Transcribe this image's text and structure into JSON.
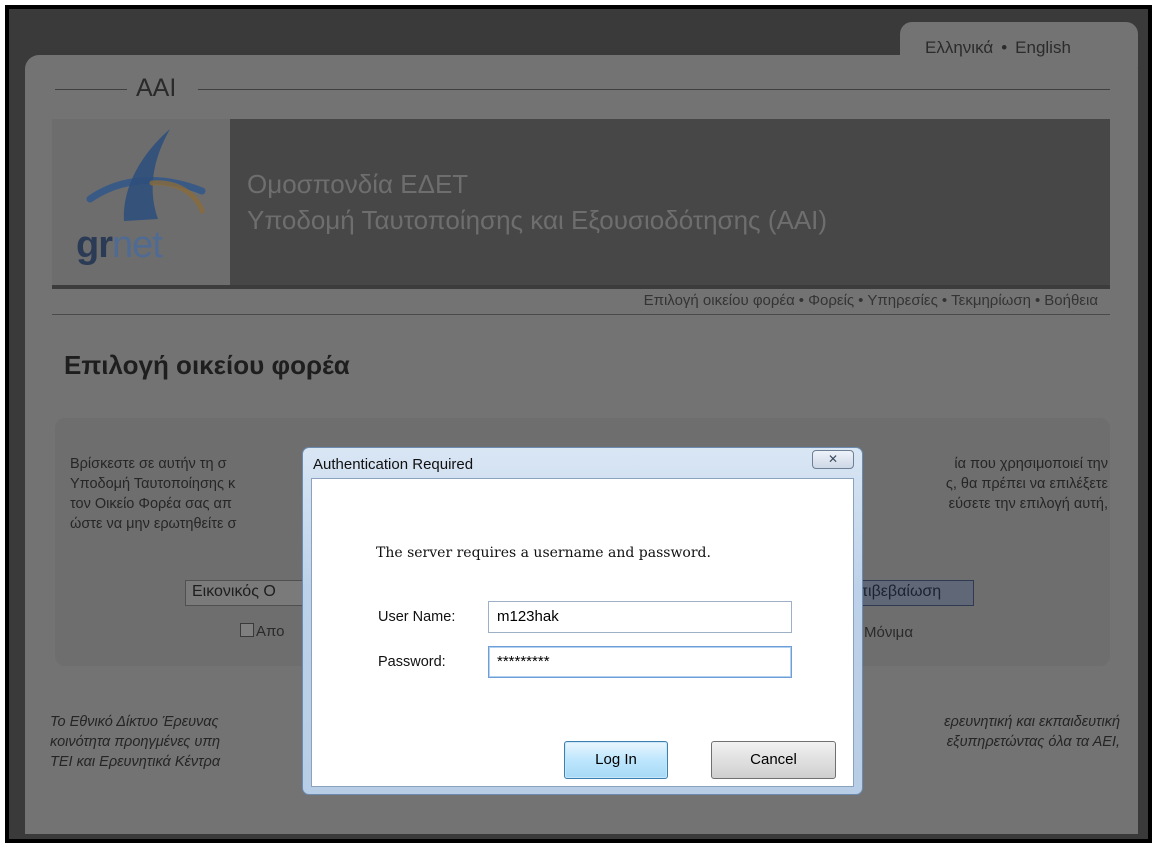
{
  "lang": {
    "greek": "Ελληνικά",
    "sep": "•",
    "english": "English"
  },
  "site": {
    "aai_title": "AAI",
    "logo": {
      "part1": "gr",
      "part2": "net"
    },
    "banner_line1": "Ομοσπονδία ΕΔΕΤ",
    "banner_line2": "Υποδομή Ταυτοποίησης και Εξουσιοδότησης (AAI)"
  },
  "nav": {
    "items": [
      "Επιλογή οικείου φορέα",
      "Φορείς",
      "Υπηρεσίες",
      "Τεκμηρίωση",
      "Βοήθεια"
    ],
    "sep": "•"
  },
  "page": {
    "heading": "Επιλογή οικείου φορέα",
    "para_left": [
      "Βρίσκεστε σε αυτήν τη σ",
      "Υποδομή Ταυτοποίησης κ",
      "τον Οικείο Φορέα σας απ",
      "ώστε να μην ερωτηθείτε σ"
    ],
    "para_right": [
      "ία που χρησιμοποιεί την",
      "ς, θα πρέπει να επιλέξετε",
      "εύσετε την επιλογή αυτή,"
    ],
    "select_value": "Εικονικός Ο",
    "confirm_label": "πιβεβαίωση",
    "checkbox_left_label": "Απο",
    "checkbox_right_label": "Μόνιμα",
    "footer_left": [
      "Το Εθνικό Δίκτυο Έρευνας",
      "κοινότητα προηγμένες υπη",
      "ΤΕΙ και Ερευνητικά Κέντρα"
    ],
    "footer_right": [
      "ερευνητική και εκπαιδευτική",
      "εξυπηρετώντας όλα τα ΑΕΙ,"
    ]
  },
  "dialog": {
    "title": "Authentication Required",
    "close_glyph": "✕",
    "message": "The server requires a username and password.",
    "username_label": "User Name:",
    "username_value": "m123hak",
    "password_label": "Password:",
    "password_value": "*********",
    "login_label": "Log In",
    "cancel_label": "Cancel"
  },
  "colors": {
    "accent": "#3c7fb1",
    "dialog_frame": "#bdd2ea"
  }
}
